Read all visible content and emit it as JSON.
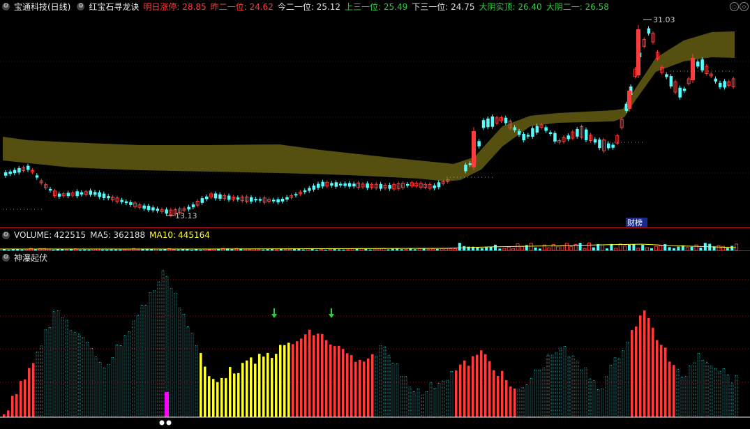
{
  "header": {
    "stock_name": "宝通科技(日线)",
    "indicator_name": "红宝石寻龙诀",
    "items": [
      {
        "label": "明日涨停:",
        "value": "28.85",
        "color": "#ff3b3b"
      },
      {
        "label": "昨二一位:",
        "value": "24.62",
        "color": "#ff3b3b"
      },
      {
        "label": "今二一位:",
        "value": "25.12",
        "color": "#e0e0e0"
      },
      {
        "label": "上三一位:",
        "value": "25.49",
        "color": "#2ecc40"
      },
      {
        "label": "下三一位:",
        "value": "24.75",
        "color": "#e0e0e0"
      },
      {
        "label": "大阴实顶:",
        "value": "26.40",
        "color": "#2ecc40"
      },
      {
        "label": "大阴二一:",
        "value": "26.58",
        "color": "#2ecc40"
      }
    ]
  },
  "price_chart": {
    "high_label": "31.03",
    "low_label": "13.13",
    "badge": "财榜"
  },
  "volume_panel": {
    "title": "VOLUME:",
    "volume": "422515",
    "ma5_label": "MA5:",
    "ma5": "362188",
    "ma10_label": "MA10:",
    "ma10": "445164"
  },
  "indicator_panel": {
    "title": "神瀑起伏"
  },
  "colors": {
    "up": "#ff3b3b",
    "down": "#54ffff",
    "band": "#5a5410",
    "panel_line": "#c41a1a",
    "yellow": "#ffff33",
    "magenta": "#ff00ff"
  },
  "icons": [
    "gear-icon",
    "arrow-down-icon",
    "restore-icon",
    "expand-icon"
  ]
}
